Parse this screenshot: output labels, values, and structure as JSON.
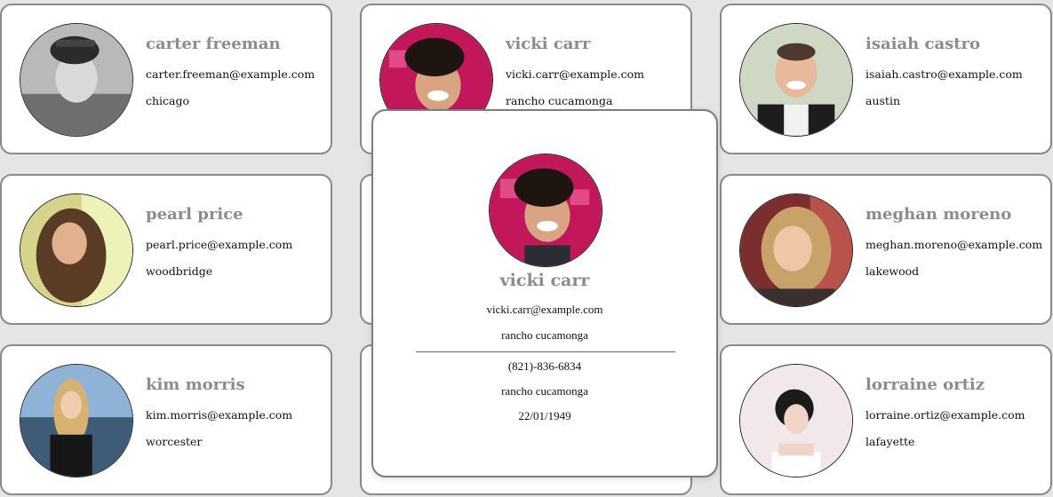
{
  "users": [
    {
      "name": "carter freeman",
      "email": "carter.freeman@example.com",
      "city": "chicago",
      "avatar": "avatar-carter"
    },
    {
      "name": "vicki carr",
      "email": "vicki.carr@example.com",
      "city": "rancho cucamonga",
      "avatar": "avatar-vicki"
    },
    {
      "name": "isaiah castro",
      "email": "isaiah.castro@example.com",
      "city": "austin",
      "avatar": "avatar-isaiah"
    },
    {
      "name": "pearl price",
      "email": "pearl.price@example.com",
      "city": "woodbridge",
      "avatar": "avatar-pearl"
    },
    {
      "name": "",
      "email": "",
      "city": "",
      "avatar": "hidden"
    },
    {
      "name": "meghan moreno",
      "email": "meghan.moreno@example.com",
      "city": "lakewood",
      "avatar": "avatar-meghan"
    },
    {
      "name": "kim morris",
      "email": "kim.morris@example.com",
      "city": "worcester",
      "avatar": "avatar-kim"
    },
    {
      "name": "",
      "email": "",
      "city": "",
      "avatar": "hidden"
    },
    {
      "name": "lorraine ortiz",
      "email": "lorraine.ortiz@example.com",
      "city": "lafayette",
      "avatar": "avatar-lorraine"
    }
  ],
  "detail": {
    "name": "vicki carr",
    "email": "vicki.carr@example.com",
    "city": "rancho cucamonga",
    "phone": "(821)-836-6834",
    "location": "rancho cucamonga",
    "dob": "22/01/1949"
  },
  "colors": {
    "background": "#e4e6e5",
    "card_border": "#8a8a8a",
    "name_text": "#8c8c8c",
    "body_text": "#111111"
  }
}
